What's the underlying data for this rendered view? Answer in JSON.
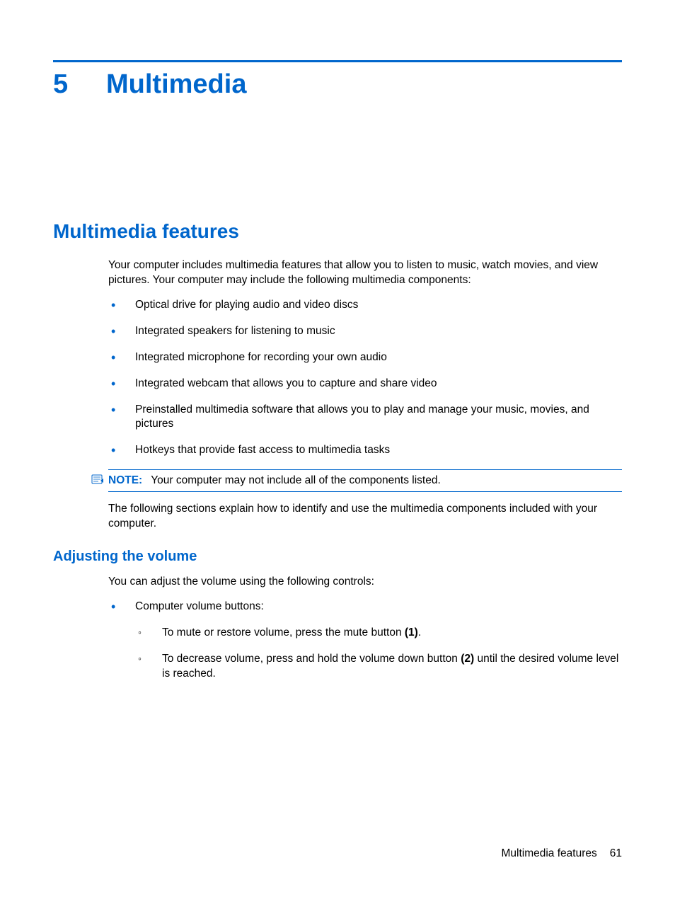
{
  "chapter": {
    "number": "5",
    "title": "Multimedia"
  },
  "section1": {
    "heading": "Multimedia features",
    "intro": "Your computer includes multimedia features that allow you to listen to music, watch movies, and view pictures. Your computer may include the following multimedia components:",
    "bullets": [
      "Optical drive for playing audio and video discs",
      "Integrated speakers for listening to music",
      "Integrated microphone for recording your own audio",
      "Integrated webcam that allows you to capture and share video",
      "Preinstalled multimedia software that allows you to play and manage your music, movies, and pictures",
      "Hotkeys that provide fast access to multimedia tasks"
    ],
    "note_label": "NOTE:",
    "note_text": "Your computer may not include all of the components listed.",
    "outro": "The following sections explain how to identify and use the multimedia components included with your computer."
  },
  "section2": {
    "heading": "Adjusting the volume",
    "intro": "You can adjust the volume using the following controls:",
    "bullet1": "Computer volume buttons:",
    "sub1_pre": "To mute or restore volume, press the mute button ",
    "sub1_bold": "(1)",
    "sub1_post": ".",
    "sub2_pre": "To decrease volume, press and hold the volume down button ",
    "sub2_bold": "(2)",
    "sub2_post": " until the desired volume level is reached."
  },
  "footer": {
    "section": "Multimedia features",
    "page": "61"
  }
}
